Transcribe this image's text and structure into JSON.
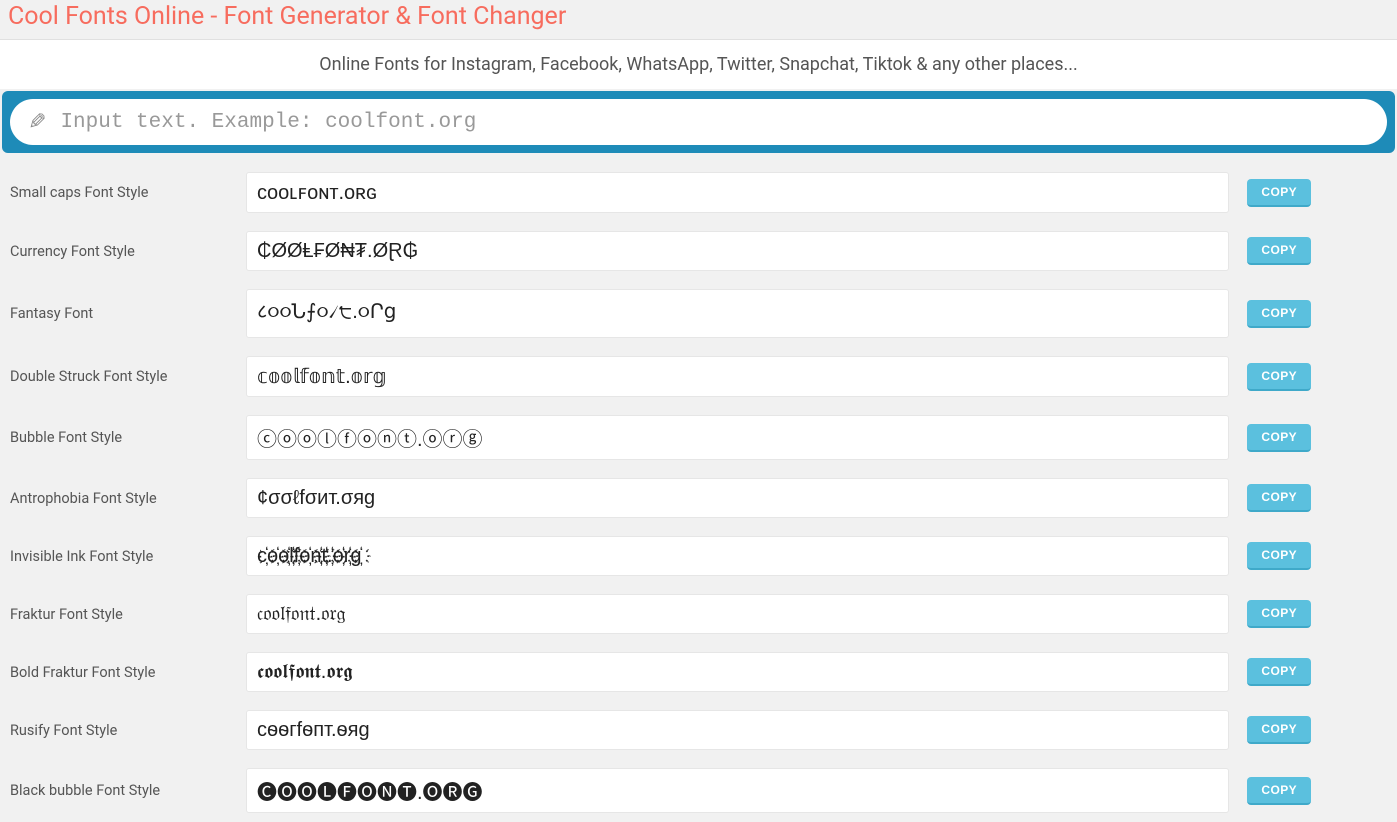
{
  "header": {
    "title": "Cool Fonts Online - Font Generator & Font Changer",
    "subtitle": "Online Fonts for Instagram, Facebook, WhatsApp, Twitter, Snapchat, Tiktok & any other places..."
  },
  "input": {
    "placeholder": "Input text. Example: coolfont.org",
    "value": ""
  },
  "copy_label": "COPY",
  "rows": [
    {
      "label": "Small caps Font Style",
      "output": "ᴄᴏᴏʟꜰᴏɴᴛ.ᴏʀɢ"
    },
    {
      "label": "Currency Font Style",
      "output": "₵ØØⱠ₣Ø₦₮.ØⱤ₲"
    },
    {
      "label": "Fantasy Font",
      "output": "८૦૦Ն⨍૦৴੮.૦Րց"
    },
    {
      "label": "Double Struck Font Style",
      "output": "𝕔𝕠𝕠𝕝𝕗𝕠𝕟𝕥.𝕠𝕣𝕘"
    },
    {
      "label": "Bubble Font Style",
      "output": "ⓒⓞⓞⓛⓕⓞⓝⓣ.ⓞⓡⓖ"
    },
    {
      "label": "Antrophobia Font Style",
      "output": "¢σσℓfσит.σяg"
    },
    {
      "label": "Invisible Ink Font Style",
      "output": "c҉o҉o҉l҉f҉o҉n҉t҉.҉o҉r҉g҉"
    },
    {
      "label": "Fraktur Font Style",
      "output": "𝔠𝔬𝔬𝔩𝔣𝔬𝔫𝔱.𝔬𝔯𝔤"
    },
    {
      "label": "Bold Fraktur Font Style",
      "output": "𝖈𝖔𝖔𝖑𝖋𝖔𝖓𝖙.𝖔𝖗𝖌"
    },
    {
      "label": "Rusify Font Style",
      "output": "cѳѳгfѳпт.ѳяg"
    },
    {
      "label": "Black bubble Font Style",
      "output": "🅒🅞🅞🅛🅕🅞🅝🅣.🅞🅡🅖"
    }
  ]
}
